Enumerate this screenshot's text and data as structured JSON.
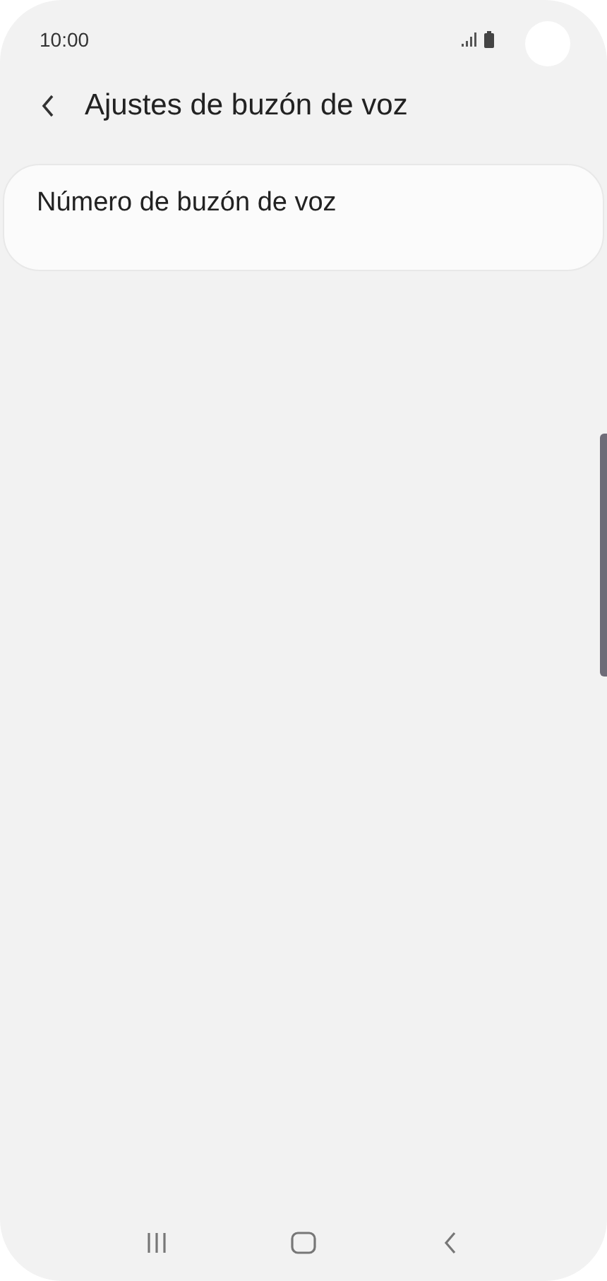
{
  "status_bar": {
    "time": "10:00"
  },
  "header": {
    "title": "Ajustes de buzón de voz"
  },
  "items": [
    {
      "title": "Número de buzón de voz"
    }
  ]
}
